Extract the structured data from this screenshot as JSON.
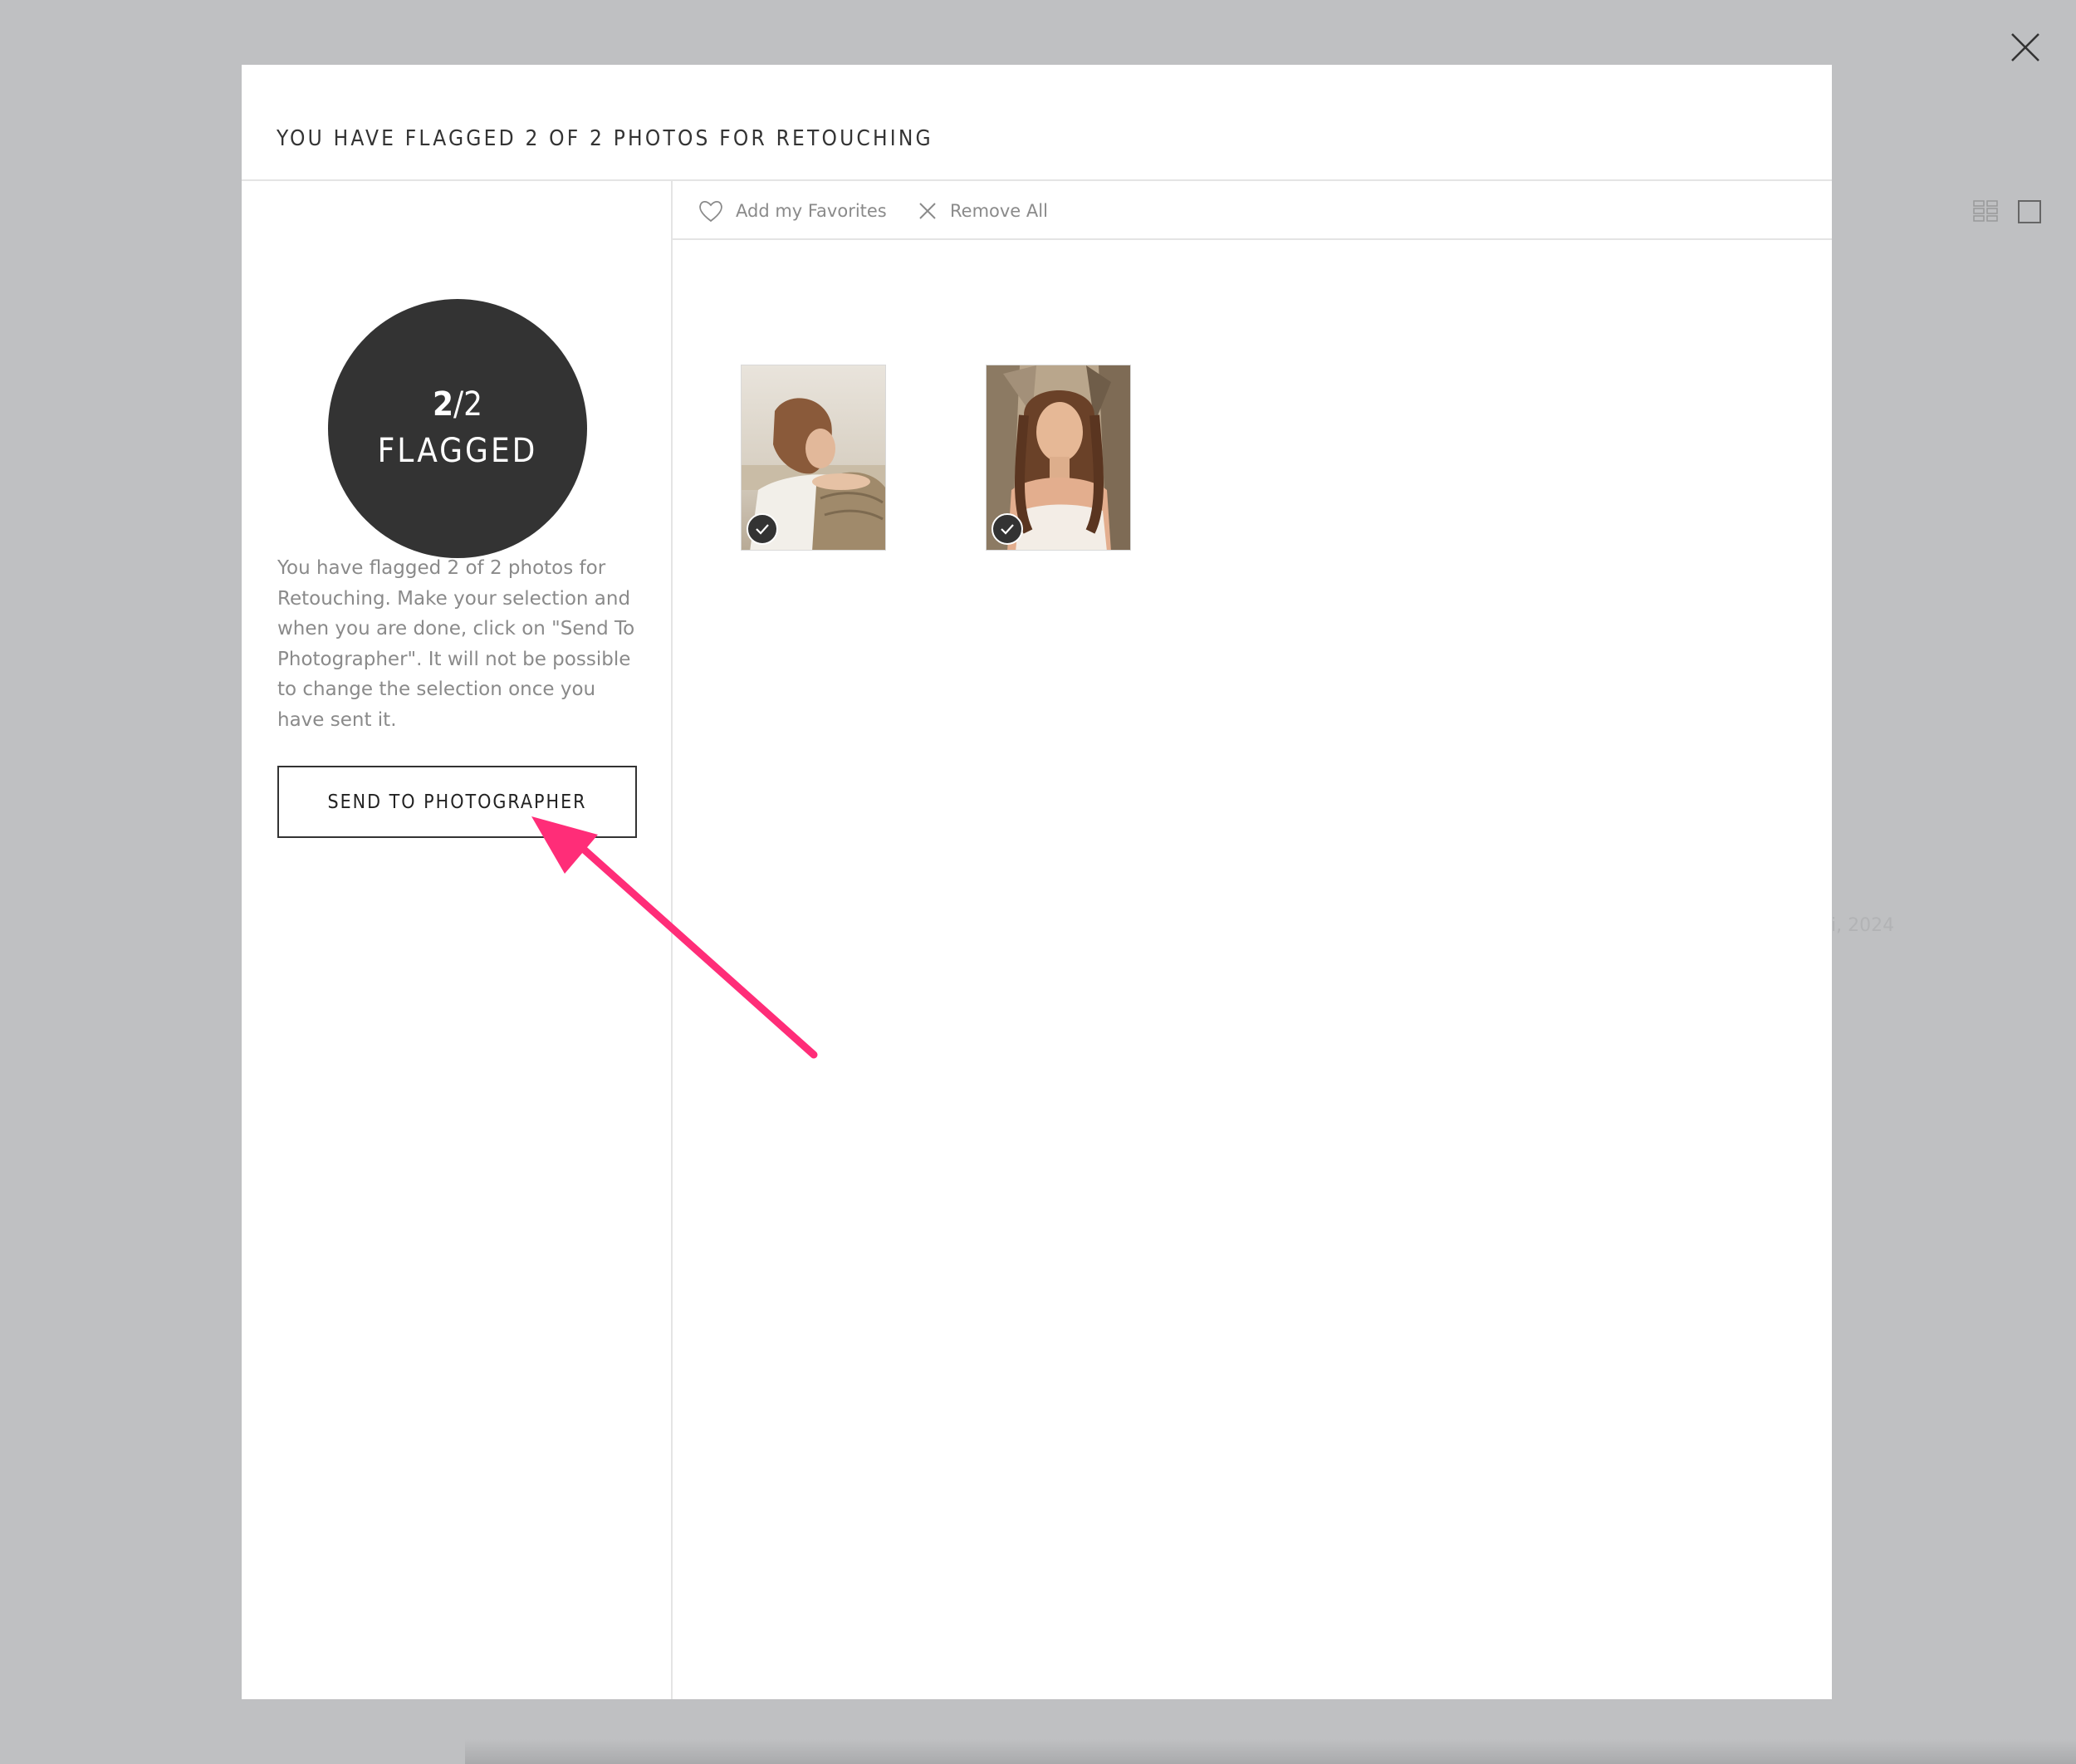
{
  "modal": {
    "title": "YOU HAVE FLAGGED 2 OF 2 PHOTOS FOR RETOUCHING"
  },
  "summary": {
    "flagged_count": "2",
    "flagged_total": "/2",
    "flagged_label": "FLAGGED",
    "description": "You have flagged 2 of 2 photos for Retouching. Make your selection and when you are done, click on \"Send To Photographer\". It will not be possible to change the selection once you have sent it.",
    "send_button": "SEND TO PHOTOGRAPHER"
  },
  "toolbar": {
    "add_favorites": "Add my Favorites",
    "remove_all": "Remove All",
    "grid_view_icon": "grid-view-icon",
    "single_view_icon": "single-view-icon"
  },
  "photos": [
    {
      "name": "photo-1",
      "selected": true
    },
    {
      "name": "photo-2",
      "selected": true
    }
  ],
  "background_ghost_text": "i, 2024",
  "colors": {
    "overlay": "#bfc0c2",
    "circle": "#333333",
    "annotation_arrow": "#ff2d78"
  }
}
